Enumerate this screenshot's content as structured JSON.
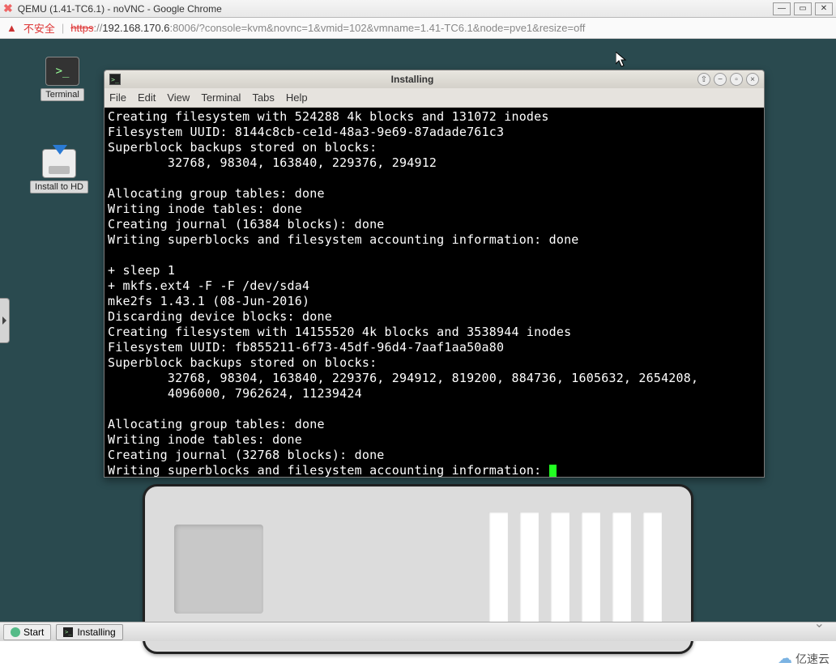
{
  "chrome": {
    "title": "QEMU (1.41-TC6.1) - noVNC - Google Chrome",
    "warn": "不安全",
    "url_proto": "https",
    "url_host": "192.168.170.6",
    "url_rest": ":8006/?console=kvm&novnc=1&vmid=102&vmname=1.41-TC6.1&node=pve1&resize=off"
  },
  "desktop": {
    "terminal_label": "Terminal",
    "install_label": "Install to HD"
  },
  "install_window": {
    "title": "Installing",
    "menu": {
      "file": "File",
      "edit": "Edit",
      "view": "View",
      "terminal": "Terminal",
      "tabs": "Tabs",
      "help": "Help"
    },
    "lines": [
      "Creating filesystem with 524288 4k blocks and 131072 inodes",
      "Filesystem UUID: 8144c8cb-ce1d-48a3-9e69-87adade761c3",
      "Superblock backups stored on blocks:",
      "        32768, 98304, 163840, 229376, 294912",
      "",
      "Allocating group tables: done",
      "Writing inode tables: done",
      "Creating journal (16384 blocks): done",
      "Writing superblocks and filesystem accounting information: done",
      "",
      "+ sleep 1",
      "+ mkfs.ext4 -F -F /dev/sda4",
      "mke2fs 1.43.1 (08-Jun-2016)",
      "Discarding device blocks: done",
      "Creating filesystem with 14155520 4k blocks and 3538944 inodes",
      "Filesystem UUID: fb855211-6f73-45df-96d4-7aaf1aa50a80",
      "Superblock backups stored on blocks:",
      "        32768, 98304, 163840, 229376, 294912, 819200, 884736, 1605632, 2654208,",
      "        4096000, 7962624, 11239424",
      "",
      "Allocating group tables: done",
      "Writing inode tables: done",
      "Creating journal (32768 blocks): done",
      "Writing superblocks and filesystem accounting information: "
    ]
  },
  "taskbar": {
    "start": "Start",
    "task1": "Installing"
  },
  "watermark": "亿速云"
}
